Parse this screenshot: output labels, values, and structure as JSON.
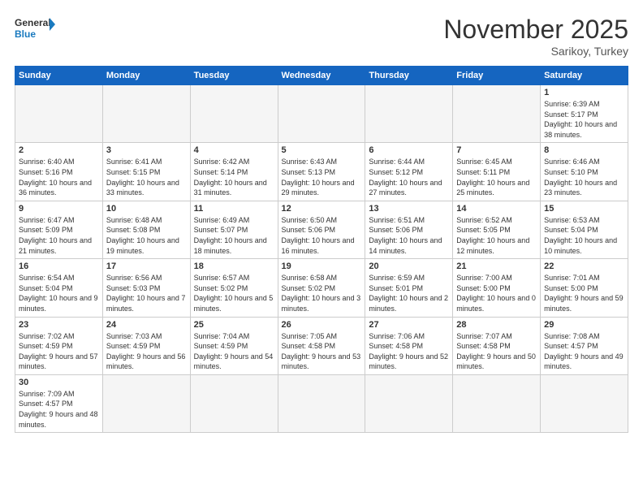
{
  "logo": {
    "general": "General",
    "blue": "Blue"
  },
  "title": "November 2025",
  "location": "Sarikoy, Turkey",
  "weekdays": [
    "Sunday",
    "Monday",
    "Tuesday",
    "Wednesday",
    "Thursday",
    "Friday",
    "Saturday"
  ],
  "weeks": [
    [
      {
        "day": "",
        "info": ""
      },
      {
        "day": "",
        "info": ""
      },
      {
        "day": "",
        "info": ""
      },
      {
        "day": "",
        "info": ""
      },
      {
        "day": "",
        "info": ""
      },
      {
        "day": "",
        "info": ""
      },
      {
        "day": "1",
        "info": "Sunrise: 6:39 AM\nSunset: 5:17 PM\nDaylight: 10 hours and 38 minutes."
      }
    ],
    [
      {
        "day": "2",
        "info": "Sunrise: 6:40 AM\nSunset: 5:16 PM\nDaylight: 10 hours and 36 minutes."
      },
      {
        "day": "3",
        "info": "Sunrise: 6:41 AM\nSunset: 5:15 PM\nDaylight: 10 hours and 33 minutes."
      },
      {
        "day": "4",
        "info": "Sunrise: 6:42 AM\nSunset: 5:14 PM\nDaylight: 10 hours and 31 minutes."
      },
      {
        "day": "5",
        "info": "Sunrise: 6:43 AM\nSunset: 5:13 PM\nDaylight: 10 hours and 29 minutes."
      },
      {
        "day": "6",
        "info": "Sunrise: 6:44 AM\nSunset: 5:12 PM\nDaylight: 10 hours and 27 minutes."
      },
      {
        "day": "7",
        "info": "Sunrise: 6:45 AM\nSunset: 5:11 PM\nDaylight: 10 hours and 25 minutes."
      },
      {
        "day": "8",
        "info": "Sunrise: 6:46 AM\nSunset: 5:10 PM\nDaylight: 10 hours and 23 minutes."
      }
    ],
    [
      {
        "day": "9",
        "info": "Sunrise: 6:47 AM\nSunset: 5:09 PM\nDaylight: 10 hours and 21 minutes."
      },
      {
        "day": "10",
        "info": "Sunrise: 6:48 AM\nSunset: 5:08 PM\nDaylight: 10 hours and 19 minutes."
      },
      {
        "day": "11",
        "info": "Sunrise: 6:49 AM\nSunset: 5:07 PM\nDaylight: 10 hours and 18 minutes."
      },
      {
        "day": "12",
        "info": "Sunrise: 6:50 AM\nSunset: 5:06 PM\nDaylight: 10 hours and 16 minutes."
      },
      {
        "day": "13",
        "info": "Sunrise: 6:51 AM\nSunset: 5:06 PM\nDaylight: 10 hours and 14 minutes."
      },
      {
        "day": "14",
        "info": "Sunrise: 6:52 AM\nSunset: 5:05 PM\nDaylight: 10 hours and 12 minutes."
      },
      {
        "day": "15",
        "info": "Sunrise: 6:53 AM\nSunset: 5:04 PM\nDaylight: 10 hours and 10 minutes."
      }
    ],
    [
      {
        "day": "16",
        "info": "Sunrise: 6:54 AM\nSunset: 5:04 PM\nDaylight: 10 hours and 9 minutes."
      },
      {
        "day": "17",
        "info": "Sunrise: 6:56 AM\nSunset: 5:03 PM\nDaylight: 10 hours and 7 minutes."
      },
      {
        "day": "18",
        "info": "Sunrise: 6:57 AM\nSunset: 5:02 PM\nDaylight: 10 hours and 5 minutes."
      },
      {
        "day": "19",
        "info": "Sunrise: 6:58 AM\nSunset: 5:02 PM\nDaylight: 10 hours and 3 minutes."
      },
      {
        "day": "20",
        "info": "Sunrise: 6:59 AM\nSunset: 5:01 PM\nDaylight: 10 hours and 2 minutes."
      },
      {
        "day": "21",
        "info": "Sunrise: 7:00 AM\nSunset: 5:00 PM\nDaylight: 10 hours and 0 minutes."
      },
      {
        "day": "22",
        "info": "Sunrise: 7:01 AM\nSunset: 5:00 PM\nDaylight: 9 hours and 59 minutes."
      }
    ],
    [
      {
        "day": "23",
        "info": "Sunrise: 7:02 AM\nSunset: 4:59 PM\nDaylight: 9 hours and 57 minutes."
      },
      {
        "day": "24",
        "info": "Sunrise: 7:03 AM\nSunset: 4:59 PM\nDaylight: 9 hours and 56 minutes."
      },
      {
        "day": "25",
        "info": "Sunrise: 7:04 AM\nSunset: 4:59 PM\nDaylight: 9 hours and 54 minutes."
      },
      {
        "day": "26",
        "info": "Sunrise: 7:05 AM\nSunset: 4:58 PM\nDaylight: 9 hours and 53 minutes."
      },
      {
        "day": "27",
        "info": "Sunrise: 7:06 AM\nSunset: 4:58 PM\nDaylight: 9 hours and 52 minutes."
      },
      {
        "day": "28",
        "info": "Sunrise: 7:07 AM\nSunset: 4:58 PM\nDaylight: 9 hours and 50 minutes."
      },
      {
        "day": "29",
        "info": "Sunrise: 7:08 AM\nSunset: 4:57 PM\nDaylight: 9 hours and 49 minutes."
      }
    ],
    [
      {
        "day": "30",
        "info": "Sunrise: 7:09 AM\nSunset: 4:57 PM\nDaylight: 9 hours and 48 minutes."
      },
      {
        "day": "",
        "info": ""
      },
      {
        "day": "",
        "info": ""
      },
      {
        "day": "",
        "info": ""
      },
      {
        "day": "",
        "info": ""
      },
      {
        "day": "",
        "info": ""
      },
      {
        "day": "",
        "info": ""
      }
    ]
  ]
}
